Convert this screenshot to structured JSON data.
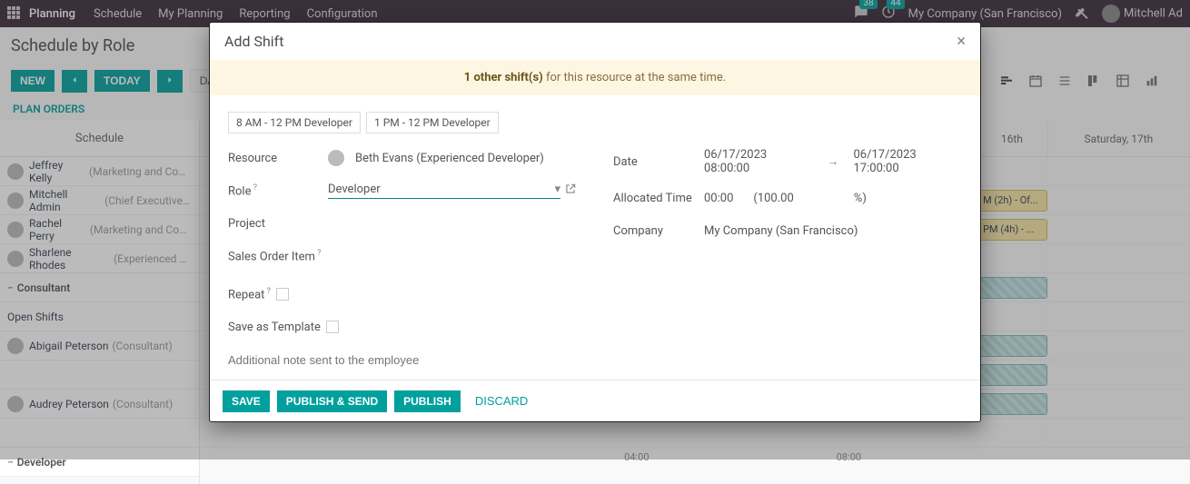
{
  "topnav": {
    "app": "Planning",
    "links": [
      "Schedule",
      "My Planning",
      "Reporting",
      "Configuration"
    ],
    "badge1": "38",
    "badge2": "44",
    "company": "My Company (San Francisco)",
    "user": "Mitchell Ad"
  },
  "page": {
    "title": "Schedule by Role",
    "new_btn": "NEW",
    "today_btn": "TODAY",
    "day_btn": "DAY",
    "plan_orders": "PLAN ORDERS",
    "schedule_hdr": "Schedule"
  },
  "days": [
    "16th",
    "Saturday, 17th"
  ],
  "rows": [
    {
      "type": "person",
      "name": "Jeffrey Kelly",
      "role": "(Marketing and Comm"
    },
    {
      "type": "person",
      "name": "Mitchell Admin",
      "role": "(Chief Executive O"
    },
    {
      "type": "person",
      "name": "Rachel Perry",
      "role": "(Marketing and Comm"
    },
    {
      "type": "person",
      "name": "Sharlene Rhodes",
      "role": "(Experienced De"
    },
    {
      "type": "group",
      "name": "Consultant"
    },
    {
      "type": "open",
      "name": "Open Shifts"
    },
    {
      "type": "person",
      "name": "Abigail Peterson",
      "role": "(Consultant)"
    },
    {
      "type": "spacer",
      "name": ""
    },
    {
      "type": "person",
      "name": "Audrey Peterson",
      "role": "(Consultant)"
    },
    {
      "type": "spacer",
      "name": ""
    },
    {
      "type": "group",
      "name": "Developer"
    }
  ],
  "shifts": {
    "s1": "M (2h) - Of...",
    "s2": "PM (4h) - ..."
  },
  "timeline": {
    "t1": "04:00",
    "t2": "08:00"
  },
  "modal": {
    "title": "Add Shift",
    "warning_bold": "1 other shift(s)",
    "warning_rest": " for this resource at the same time.",
    "chip1": "8 AM - 12 PM Developer",
    "chip2": "1 PM - 12 PM Developer",
    "labels": {
      "resource": "Resource",
      "role": "Role",
      "project": "Project",
      "sales_order": "Sales Order Item",
      "date": "Date",
      "allocated": "Allocated Time",
      "company": "Company",
      "repeat": "Repeat",
      "save_tpl": "Save as Template"
    },
    "values": {
      "resource": "Beth Evans (Experienced Developer)",
      "role": "Developer",
      "date_from": "06/17/2023 08:00:00",
      "date_to": "06/17/2023 17:00:00",
      "alloc_time": "00:00",
      "alloc_pct_open": "(100.00",
      "alloc_pct_unit": "%)",
      "company": "My Company (San Francisco)"
    },
    "note_placeholder": "Additional note sent to the employee",
    "buttons": {
      "save": "SAVE",
      "pub_send": "PUBLISH & SEND",
      "publish": "PUBLISH",
      "discard": "DISCARD"
    }
  }
}
